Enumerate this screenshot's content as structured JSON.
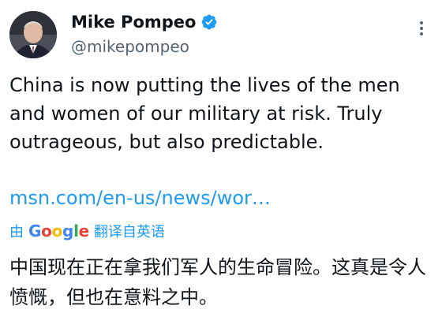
{
  "author": {
    "display_name": "Mike Pompeo",
    "handle": "@mikepompeo",
    "verified_color": "#1d9bf0"
  },
  "icons": {
    "verified": "verified-badge-icon",
    "more": "more-options-icon"
  },
  "tweet": {
    "text": "China is now putting the lives of the men and women of our military at risk. Truly outrageous, but also predictable.",
    "link": "msn.com/en-us/news/wor…"
  },
  "translation": {
    "prefix": "由",
    "provider_letters": [
      "G",
      "o",
      "o",
      "g",
      "l",
      "e"
    ],
    "provider_colors": [
      "#4285F4",
      "#EA4335",
      "#FBBC05",
      "#4285F4",
      "#34A853",
      "#EA4335"
    ],
    "action": "翻译自英语",
    "text": "中国现在正在拿我们军人的生命冒险。这真是令人愤慨，但也在意料之中。"
  },
  "colors": {
    "text": "#0f1419",
    "secondary": "#536471",
    "link": "#1d9bf0"
  }
}
